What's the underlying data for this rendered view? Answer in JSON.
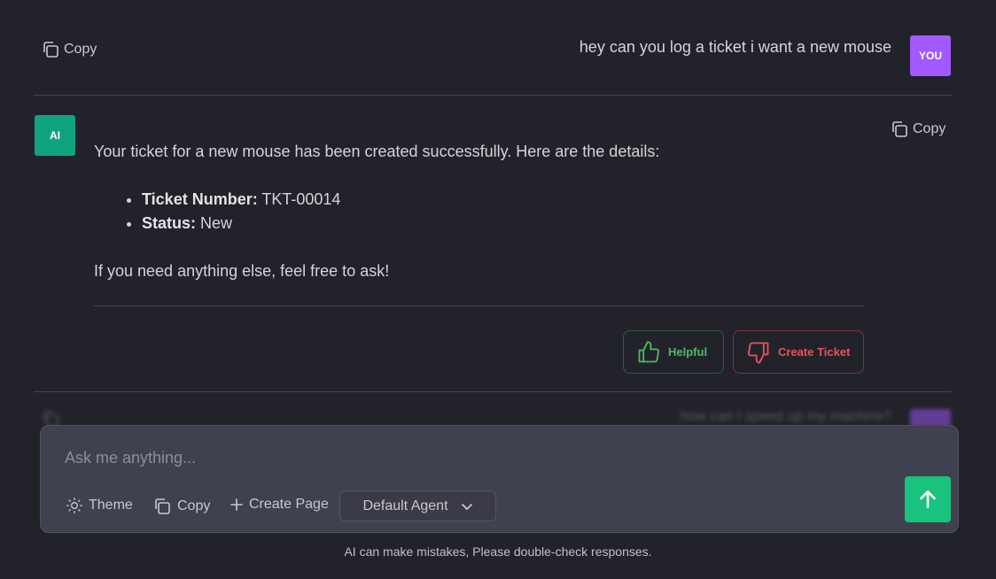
{
  "colors": {
    "background": "#22222a",
    "user_avatar": "#a259ff",
    "ai_avatar": "#10a37f",
    "helpful": "#4fba62",
    "create_ticket": "#e2555e",
    "send_button": "#19c37d",
    "input_bg": "#40414e"
  },
  "messages": {
    "user": {
      "copy_label": "Copy",
      "text": "hey can you log a ticket i want a new mouse",
      "avatar": "YOU"
    },
    "ai": {
      "avatar": "AI",
      "copy_label": "Copy",
      "intro": "Your ticket for a new mouse has been created successfully. Here are the details:",
      "details": [
        {
          "label": "Ticket Number:",
          "value": "TKT-00014"
        },
        {
          "label": "Status:",
          "value": "New"
        }
      ],
      "outro": "If you need anything else, feel free to ask!",
      "helpful_label": "Helpful",
      "create_ticket_label": "Create Ticket"
    },
    "next_user": {
      "text": "how can I speed up my machine?"
    }
  },
  "composer": {
    "placeholder": "Ask me anything...",
    "theme_label": "Theme",
    "copy_label": "Copy",
    "create_page_label": "Create Page",
    "agent_selected": "Default Agent"
  },
  "disclaimer": "AI can make mistakes, Please double-check responses.",
  "icons": {
    "copy": "copy-icon",
    "theme": "sun-icon",
    "create_page": "plus-icon",
    "agent": "chevron-down-icon",
    "send": "arrow-up-icon",
    "helpful": "thumbs-up-icon",
    "create_ticket": "thumbs-down-icon"
  }
}
